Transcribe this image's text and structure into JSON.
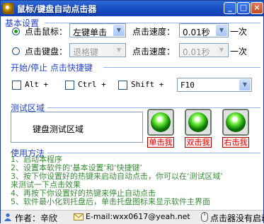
{
  "window": {
    "title": "鼠标/键盘自动点击器",
    "minimize_glyph": "_",
    "maximize_glyph": "□",
    "close_glyph": "×"
  },
  "basic": {
    "title": "基本设置",
    "mouse_label": "点击鼠标：",
    "mouse_value": "左键单击",
    "speed_label": "点击速度：",
    "speed_value": "0.01秒",
    "per_suffix": "一次",
    "keyboard_label": "点击键盘：",
    "keyboard_value": "退格键",
    "speed2_label": "点击速度：",
    "speed2_value": "0.01秒",
    "per2_suffix": "一次"
  },
  "hotkey": {
    "title": "开始/停止 点击快捷键",
    "alt_label": "Alt +",
    "ctrl_label": "Ctrl +",
    "shift_label": "Shift +",
    "key_value": "F10"
  },
  "test": {
    "title": "测试区域",
    "area_text": "键盘测试区域",
    "single_label": "单击我",
    "double_label": "双击我",
    "right_label": "右击我"
  },
  "usage": {
    "title": "使用方法",
    "lines": [
      "1、启动本程序",
      "2、设置本软件的‘基本设置’和‘快捷键’",
      "3、按下你设置好的热键来启动自动点击，你可以在‘测试区域’",
      "来测试一下点击效果",
      "4、再按下你设置好的热键来停止自动点击",
      "5、软件最小化到托盘后，单击托盘图标来显示软件主界面"
    ]
  },
  "status": {
    "author": "作者：辛欣",
    "email": "E-mail:wxx0617@yeah.net",
    "state": "点击器没有启动"
  },
  "colors": {
    "title_bar": "#1a4fc4",
    "section_title": "#2244cc",
    "usage_text": "#3a8a3a",
    "hit_label": "#e00000"
  },
  "icons": {
    "app": "app-icon",
    "author": "person-icon",
    "email": "mail-icon",
    "state": "mouse-icon"
  }
}
